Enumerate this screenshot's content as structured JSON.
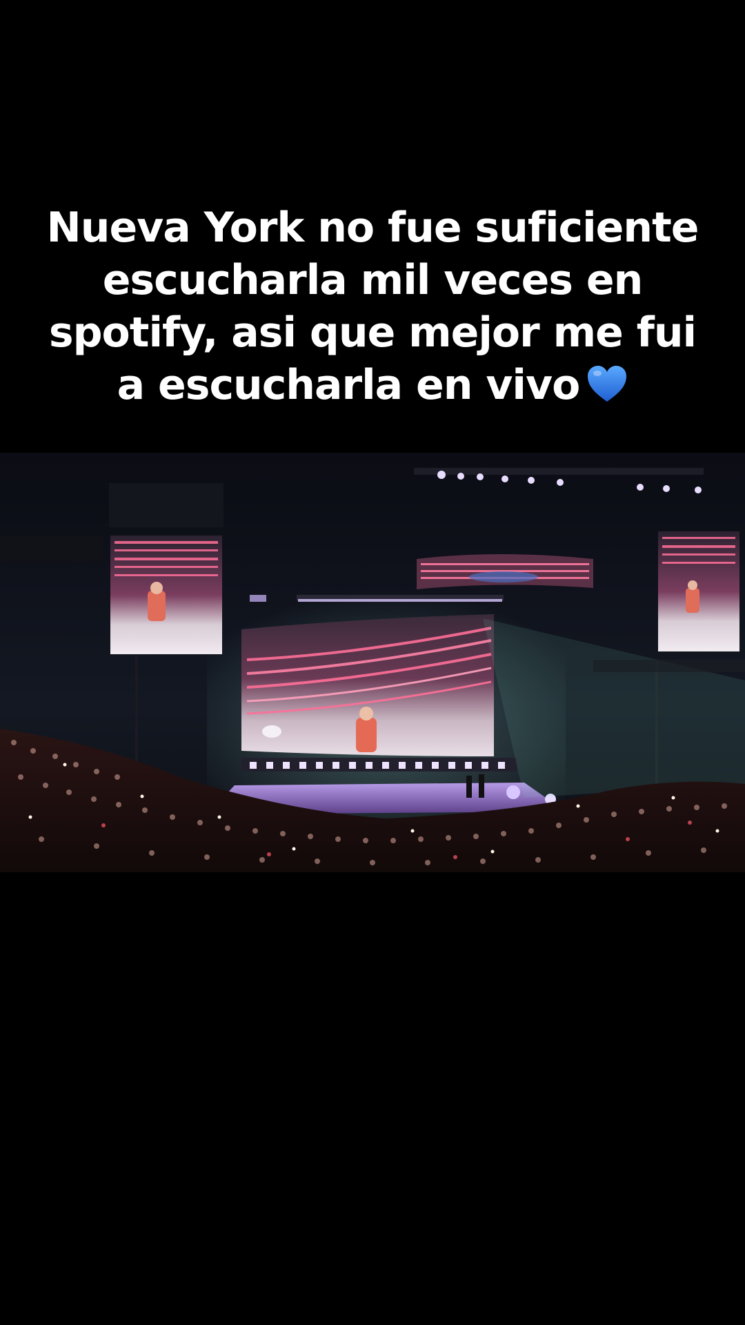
{
  "caption": {
    "text": "Nueva York no fue suficiente escucharla mil veces en spotify, asi que mejor me fui a escucharla en vivo",
    "emoji": "blue-heart",
    "emoji_color": "#2f7fe6"
  },
  "video": {
    "subject": "concert-arena-stage-crowd"
  },
  "colors": {
    "background": "#000000",
    "caption_text": "#ffffff",
    "stage_light": "#c9a6ff",
    "crowd_glow": "#ff5a8a"
  }
}
